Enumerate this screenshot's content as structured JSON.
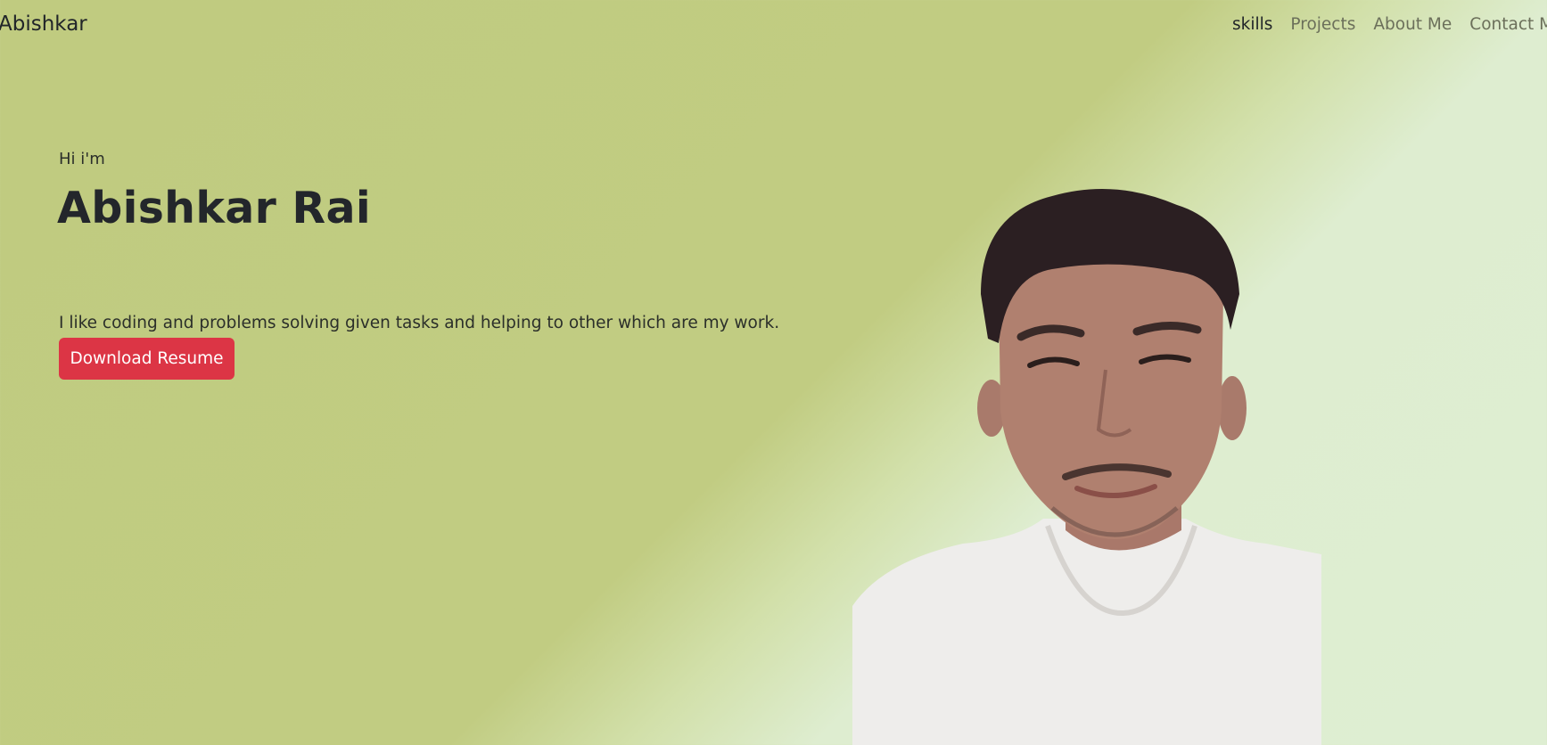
{
  "navbar": {
    "brand": "Abishkar",
    "links": [
      {
        "label": "skills",
        "active": true
      },
      {
        "label": "Projects",
        "active": false
      },
      {
        "label": "About Me",
        "active": false
      },
      {
        "label": "Contact Me",
        "active": false
      }
    ]
  },
  "hero": {
    "greeting": "Hi i'm",
    "name": "Abishkar Rai",
    "tagline": "I like coding and problems solving given tasks and helping to other which are my work.",
    "button_label": "Download Resume",
    "portrait_icon": "profile-photo"
  },
  "colors": {
    "background": "#c1cc82",
    "accent": "#dc3545",
    "text": "#212529"
  }
}
